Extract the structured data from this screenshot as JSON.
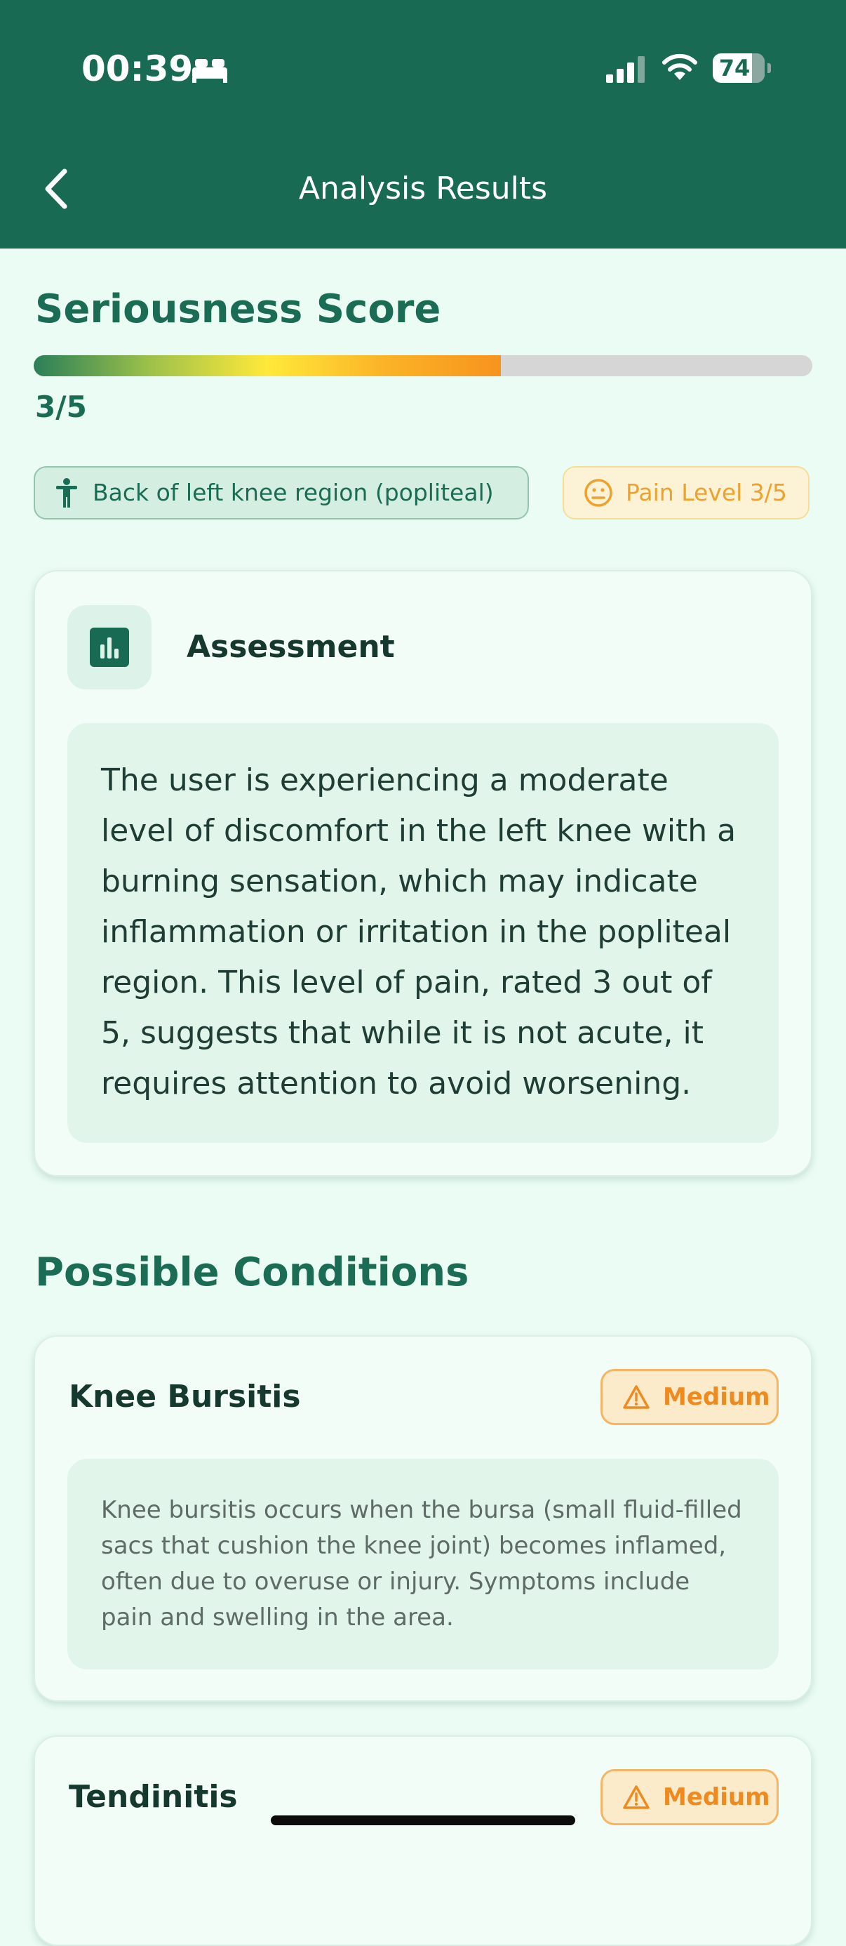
{
  "status_bar": {
    "time": "00:39",
    "battery": "74"
  },
  "nav": {
    "title": "Analysis Results"
  },
  "score": {
    "title": "Seriousness Score",
    "value_text": "3/5",
    "value": 3,
    "max": 5,
    "gradient_colors": [
      "#2A7F58",
      "#9EC14A",
      "#FFE93A",
      "#FBB327",
      "#F7941D"
    ]
  },
  "chips": {
    "region": "Back of left knee region (popliteal)",
    "pain": "Pain Level 3/5"
  },
  "assessment": {
    "title": "Assessment",
    "text": "The user is experiencing a moderate level of discomfort in the left knee with a burning sensation, which may indicate inflammation or irritation in the popliteal region. This level of pain, rated 3 out of 5, suggests that while it is not acute, it requires attention to avoid worsening."
  },
  "conditions": {
    "title": "Possible Conditions",
    "items": [
      {
        "name": "Knee Bursitis",
        "severity": "Medium",
        "description": "Knee bursitis occurs when the bursa (small fluid-filled sacs that cushion the knee joint) becomes inflamed, often due to overuse or injury. Symptoms include pain and swelling in the area."
      },
      {
        "name": "Tendinitis",
        "severity": "Medium"
      }
    ]
  },
  "colors": {
    "header": "#196A53",
    "background": "#EAFCF3",
    "accent_green": "#1B6C54",
    "warning_orange": "#EF8A1E"
  }
}
